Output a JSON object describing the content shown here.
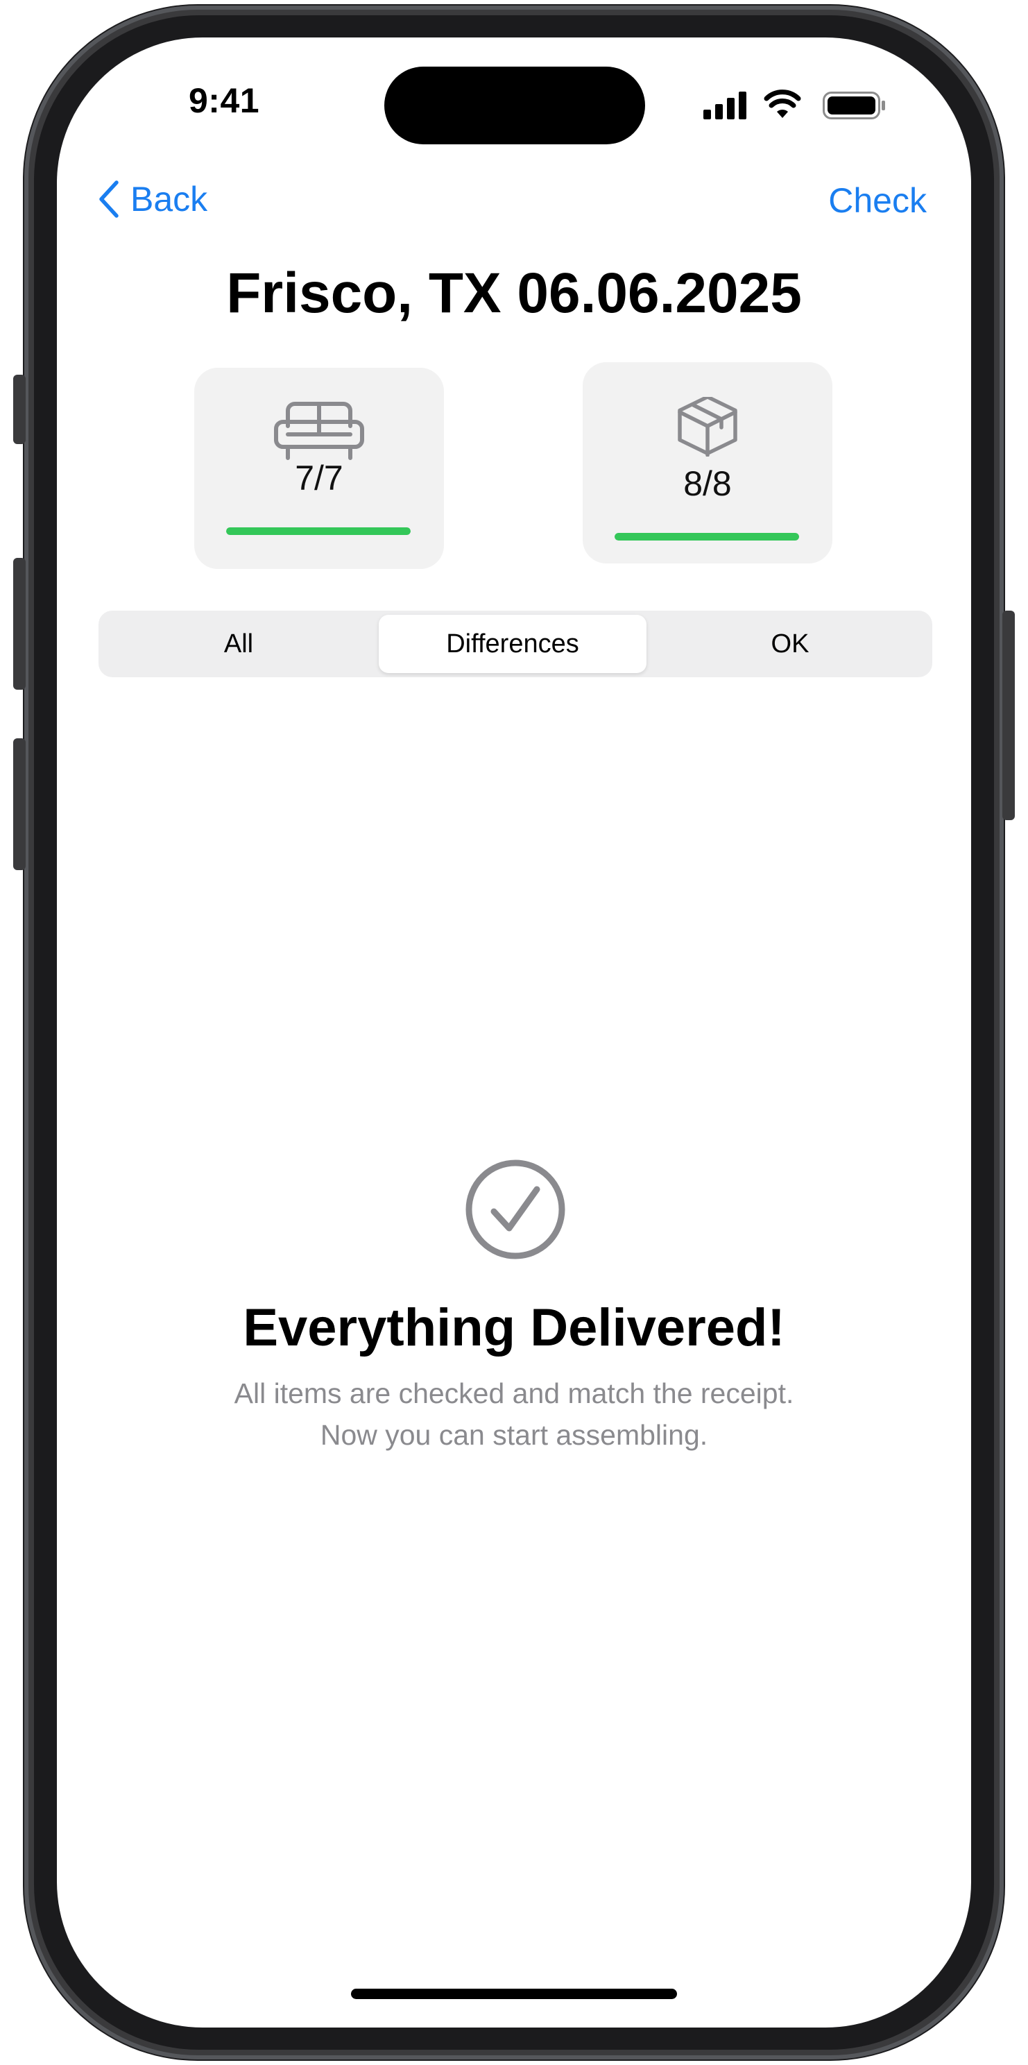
{
  "status_bar": {
    "time": "9:41",
    "icons": [
      "cellular-signal-icon",
      "wifi-icon",
      "battery-icon"
    ]
  },
  "nav": {
    "back_label": "Back",
    "check_label": "Check"
  },
  "title": "Frisco, TX 06.06.2025",
  "summary_cards": [
    {
      "icon": "sofa-icon",
      "label": "7/7",
      "progress": 1.0
    },
    {
      "icon": "box-icon",
      "label": "8/8",
      "progress": 1.0
    }
  ],
  "segments": {
    "items": [
      "All",
      "Differences",
      "OK"
    ],
    "selected": "Differences"
  },
  "empty_state": {
    "icon": "checkmark-circle-icon",
    "title": "Everything Delivered!",
    "line1": "All items are checked and match the receipt.",
    "line2": "Now you can start assembling."
  },
  "colors": {
    "accent": "#1a7ef0",
    "progress": "#34c759",
    "secondary_text": "#8a8a8e"
  }
}
